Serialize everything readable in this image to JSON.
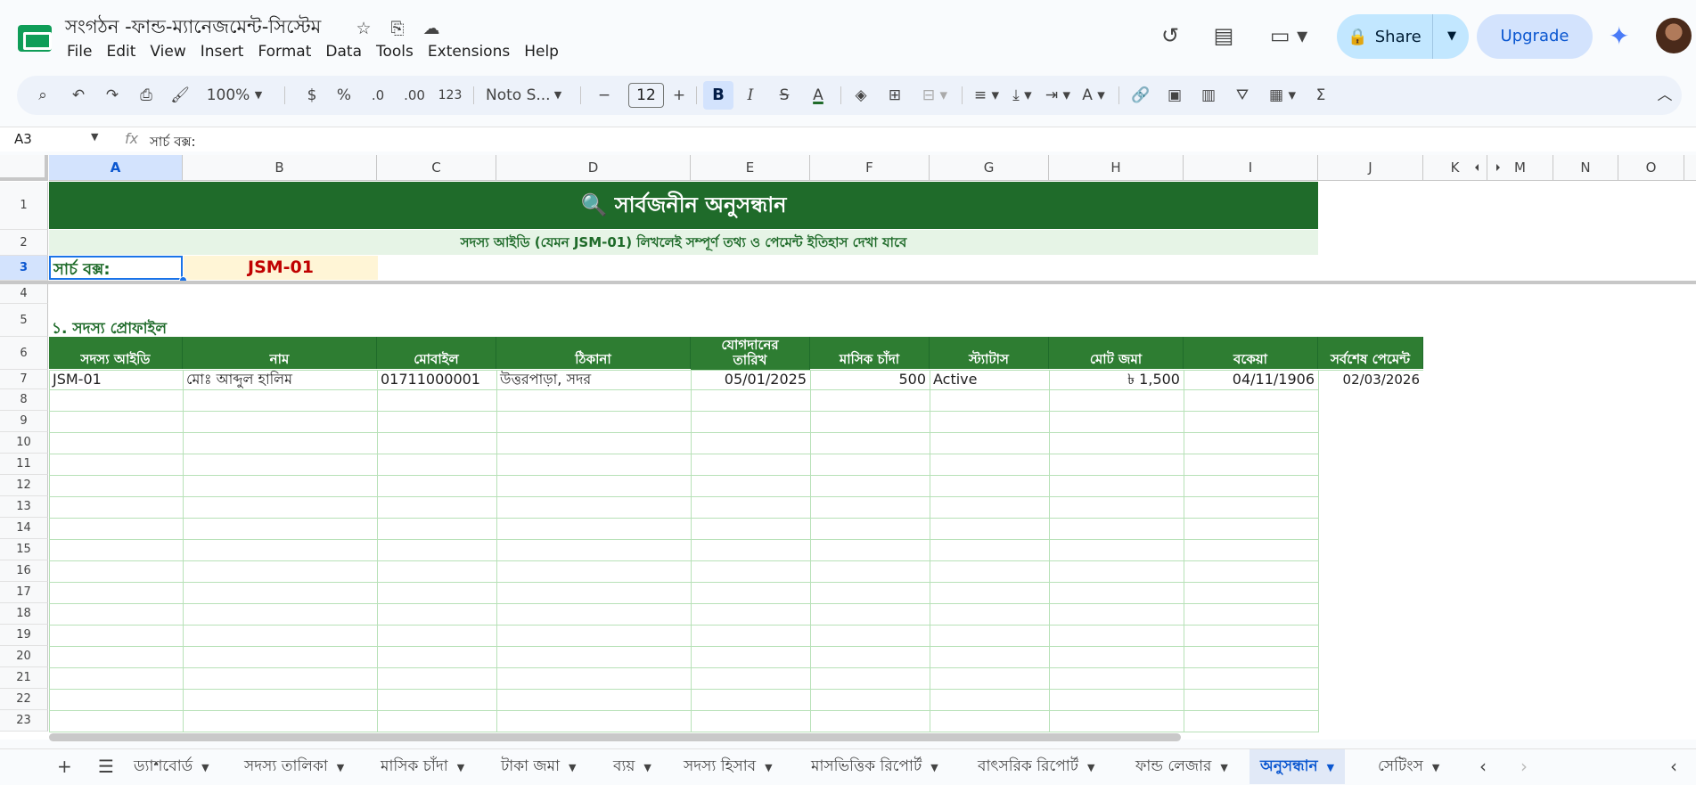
{
  "doc": {
    "title": "সংগঠন -ফান্ড-ম্যানেজমেন্ট-সিস্টেম",
    "menus": [
      "File",
      "Edit",
      "View",
      "Insert",
      "Format",
      "Data",
      "Tools",
      "Extensions",
      "Help"
    ],
    "share_label": "Share",
    "upgrade_label": "Upgrade"
  },
  "toolbar": {
    "zoom": "100%",
    "currency": "$",
    "percent": "%",
    "dec_decrease": ".0",
    "dec_increase": ".00",
    "number_format": "123",
    "font": "Noto S...",
    "font_size": "12",
    "bold": "B",
    "italic": "I"
  },
  "formula_bar": {
    "cell_ref": "A3",
    "fx": "fx",
    "value": "সার্চ বক্স:"
  },
  "columns": [
    "A",
    "B",
    "C",
    "D",
    "E",
    "F",
    "G",
    "H",
    "I",
    "J",
    "K",
    "M",
    "N",
    "O"
  ],
  "rows": [
    "1",
    "2",
    "3",
    "4",
    "5",
    "6",
    "7",
    "8",
    "9",
    "10",
    "11",
    "12",
    "13",
    "14",
    "15",
    "16",
    "17",
    "18",
    "19",
    "20",
    "21",
    "22",
    "23"
  ],
  "sheet": {
    "banner": "🔍 সার্বজনীন অনুসন্ধান",
    "subbanner": "সদস্য আইডি (যেমন JSM-01) লিখলেই সম্পূর্ণ তথ্য ও পেমেন্ট ইতিহাস দেখা যাবে",
    "search_label": "সার্চ বক্স:",
    "search_value": "JSM-01",
    "section_title": "১. সদস্য প্রোফাইল",
    "headers": [
      "সদস্য আইডি",
      "নাম",
      "মোবাইল",
      "ঠিকানা",
      "যোগদানের তারিখ",
      "মাসিক চাঁদা",
      "স্ট্যাটাস",
      "মোট জমা",
      "বকেয়া",
      "সর্বশেষ পেমেন্ট"
    ],
    "row": [
      "JSM-01",
      "মোঃ আব্দুল হালিম",
      "01711000001",
      "উত্তরপাড়া, সদর",
      "05/01/2025",
      "500",
      "Active",
      "৳ 1,500",
      "04/11/1906",
      "02/03/2026"
    ]
  },
  "tabs": [
    "ড্যাশবোর্ড",
    "সদস্য তালিকা",
    "মাসিক চাঁদা",
    "টাকা জমা",
    "ব্যয়",
    "সদস্য হিসাব",
    "মাসভিত্তিক রিপোর্ট",
    "বাৎসরিক রিপোর্ট",
    "ফান্ড লেজার",
    "অনুসন্ধান",
    "সেটিংস"
  ],
  "active_tab": "অনুসন্ধান",
  "colors": {
    "header_green": "#1f6b2a",
    "table_green": "#2e7d32",
    "search_value_red": "#c00000",
    "search_value_bg": "#fff5d6",
    "accent_blue": "#0b57d0"
  }
}
